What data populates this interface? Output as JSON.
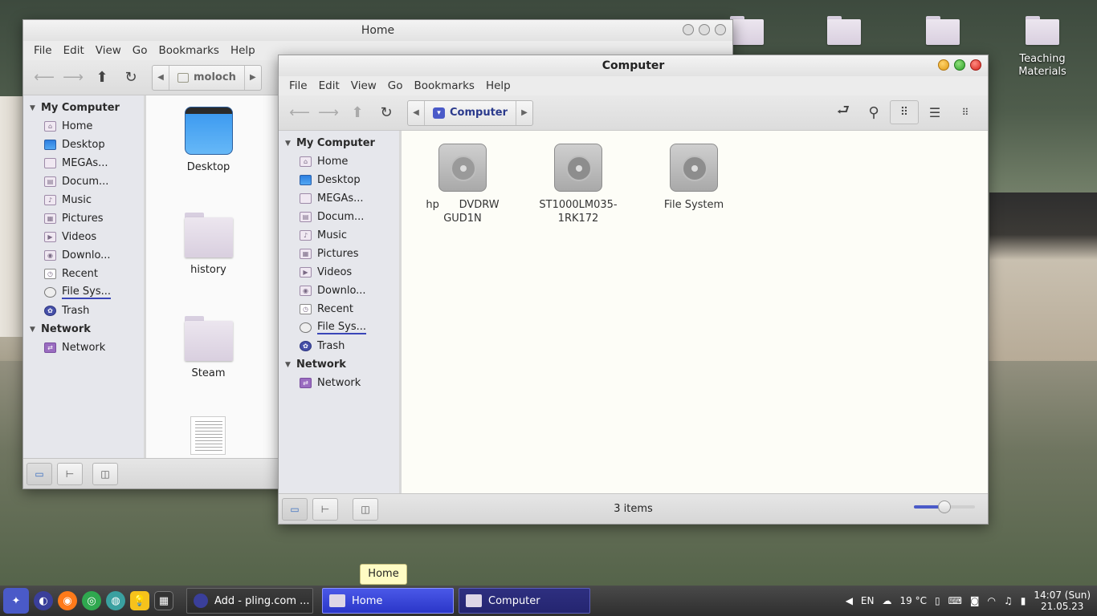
{
  "desktop": {
    "icons": [
      {
        "label": ""
      },
      {
        "label": ""
      },
      {
        "label": ""
      },
      {
        "label": "Teaching Materials"
      }
    ]
  },
  "home_window": {
    "title": "Home",
    "menu": [
      "File",
      "Edit",
      "View",
      "Go",
      "Bookmarks",
      "Help"
    ],
    "breadcrumb": "moloch",
    "sidebar": {
      "section1": "My Computer",
      "items": [
        "Home",
        "Desktop",
        "MEGAs...",
        "Docum...",
        "Music",
        "Pictures",
        "Videos",
        "Downlo...",
        "Recent",
        "File Sys...",
        "Trash"
      ],
      "section2": "Network",
      "network_items": [
        "Network"
      ]
    },
    "files": [
      {
        "label": "Desktop",
        "kind": "desktop"
      },
      {
        "label": "history",
        "kind": "folder"
      },
      {
        "label": "Steam",
        "kind": "folder"
      },
      {
        "label": "",
        "kind": "document"
      }
    ]
  },
  "computer_window": {
    "title": "Computer",
    "menu": [
      "File",
      "Edit",
      "View",
      "Go",
      "Bookmarks",
      "Help"
    ],
    "breadcrumb": "Computer",
    "sidebar": {
      "section1": "My Computer",
      "items": [
        "Home",
        "Desktop",
        "MEGAs...",
        "Docum...",
        "Music",
        "Pictures",
        "Videos",
        "Downlo...",
        "Recent",
        "File Sys...",
        "Trash"
      ],
      "section2": "Network",
      "network_items": [
        "Network"
      ]
    },
    "items": [
      {
        "label_line1": "hp      DVDRW",
        "label_line2": "GUD1N",
        "icon": "optical-drive-icon"
      },
      {
        "label_line1": "ST1000LM035-",
        "label_line2": "1RK172",
        "icon": "hard-drive-icon"
      },
      {
        "label_line1": "File System",
        "label_line2": "",
        "icon": "hard-drive-icon"
      }
    ],
    "status": "3 items",
    "zoom_level": 0.5
  },
  "tooltip": "Home",
  "taskbar": {
    "tasks": [
      "Add - pling.com ...",
      "Home",
      "Computer"
    ],
    "tray": {
      "keyboard_layout": "EN",
      "temperature": "19 °C"
    },
    "clock_time": "14:07 (Sun)",
    "clock_date": "21.05.23"
  }
}
